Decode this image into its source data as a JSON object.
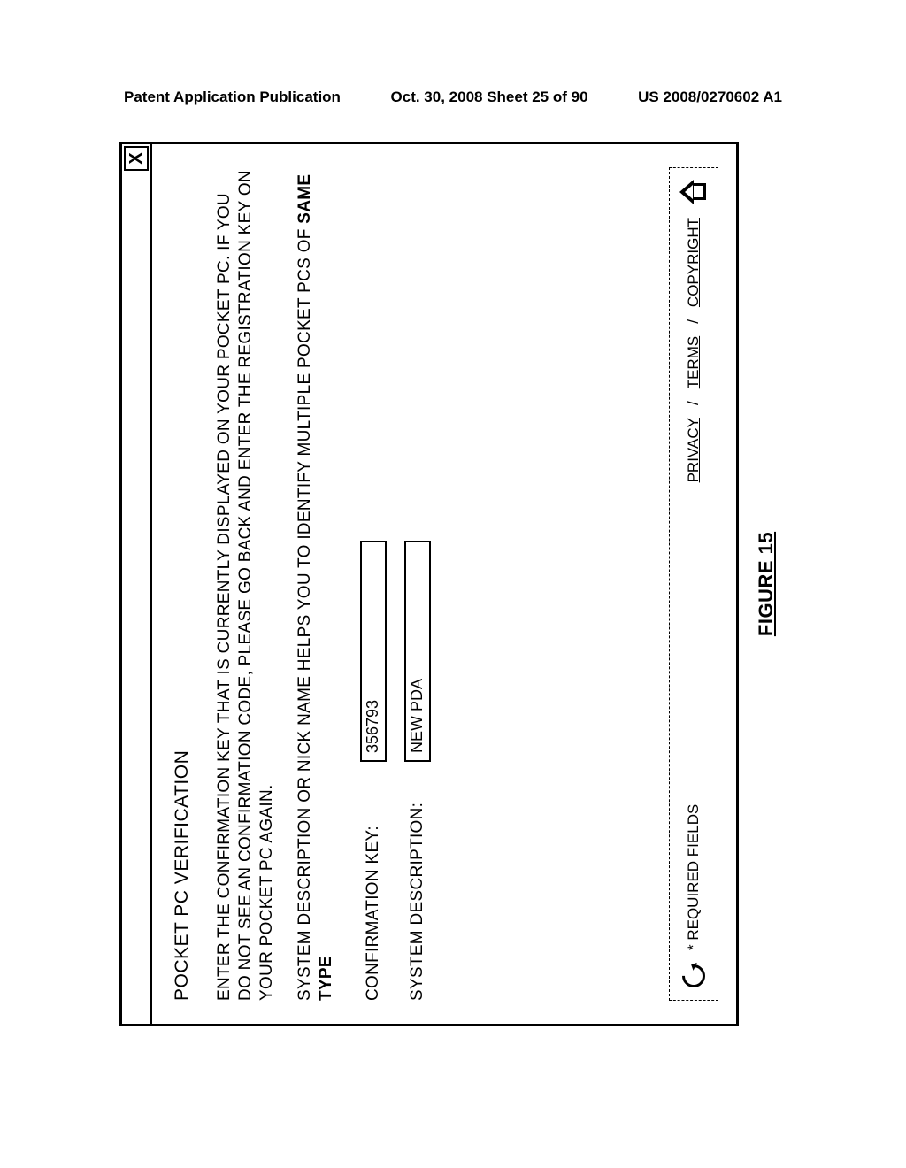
{
  "document_header": {
    "left": "Patent Application Publication",
    "mid": "Oct. 30, 2008  Sheet 25 of 90",
    "right": "US 2008/0270602 A1"
  },
  "dialog": {
    "close_label": "X",
    "heading": "POCKET PC VERIFICATION",
    "para1": "ENTER THE CONFIRMATION KEY THAT IS CURRENTLY DISPLAYED ON YOUR POCKET PC. IF YOU DO NOT SEE AN CONFIRMATION CODE, PLEASE GO BACK AND ENTER THE REGISTRATION KEY ON YOUR POCKET PC AGAIN.",
    "para2_part1": "SYSTEM DESCRIPTION OR NICK NAME HELPS YOU TO IDENTIFY MULTIPLE POCKET PCS OF ",
    "para2_part2": "SAME TYPE",
    "fields": {
      "confirmation_label": "CONFIRMATION KEY:",
      "confirmation_value": "356793",
      "sysdesc_label": "SYSTEM DESCRIPTION:",
      "sysdesc_value": "NEW PDA"
    },
    "footer": {
      "required": "* REQUIRED FIELDS",
      "privacy": "PRIVACY",
      "sep1": "/",
      "terms": "TERMS",
      "sep2": "/",
      "copyright": "COPYRIGHT"
    }
  },
  "figure_label": "FIGURE 15"
}
